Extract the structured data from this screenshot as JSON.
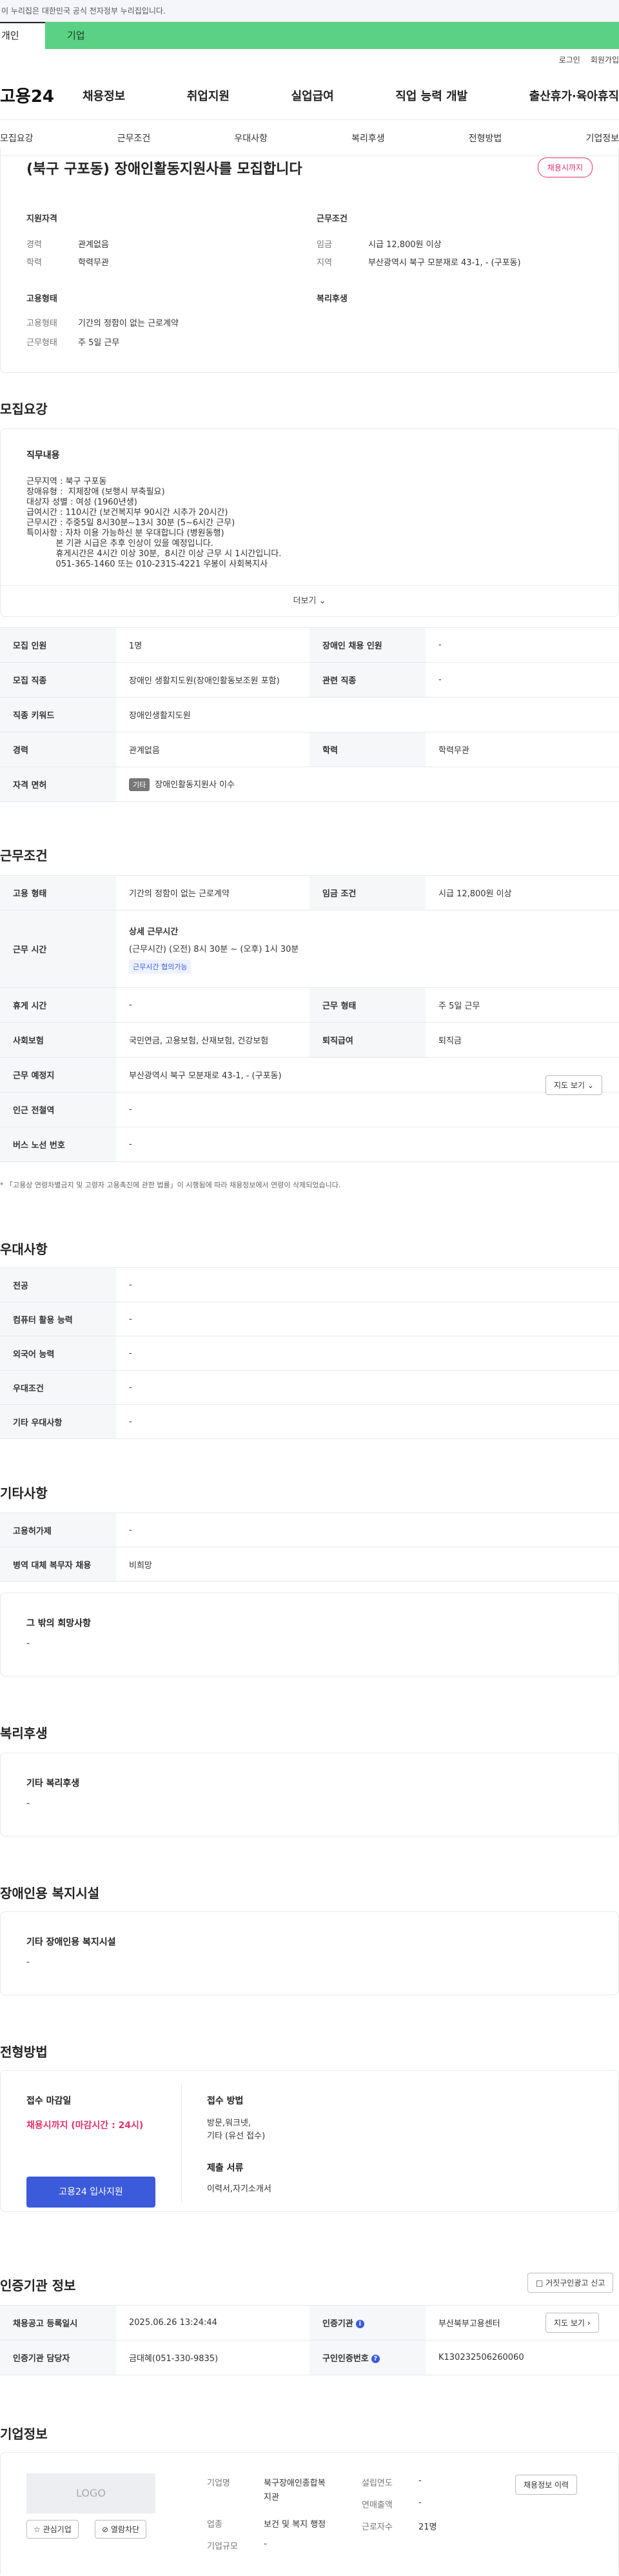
{
  "gov_notice": "이 누리집은 대한민국 공식 전자정부 누리집입니다.",
  "usertype": {
    "personal": "개인",
    "corporate": "기업"
  },
  "util": {
    "login": "로그인",
    "signup": "회원가입"
  },
  "logo": "고용24",
  "gnb": [
    "채용정보",
    "취업지원",
    "실업급여",
    "직업 능력 개발",
    "출산휴가·육아휴직"
  ],
  "tabs": [
    "모집요강",
    "근무조건",
    "우대사항",
    "복리후생",
    "전형방법",
    "기업정보"
  ],
  "job": {
    "title": "(북구 구포동) 장애인활동지원사를 모집합니다",
    "badge": "채용시까지",
    "qual_h": "지원자격",
    "cond_h": "근무조건",
    "career_k": "경력",
    "career_v": "관계없음",
    "edu_k": "학력",
    "edu_v": "학력무관",
    "wage_k": "임금",
    "wage_v": "시급 12,800원 이상",
    "region_k": "지역",
    "region_v": "부산광역시 북구 모분재로 43-1, - (구포동)",
    "emp_h": "고용형태",
    "welfare_h": "복리후생",
    "emptype_k": "고용형태",
    "emptype_v": "기간의 정함이 없는 근로계약",
    "worktype_k": "근무형태",
    "worktype_v": "주 5일 근무"
  },
  "recruit": {
    "title": "모집요강",
    "duty_h": "직무내용",
    "duty_lines": [
      "근무지역 : 북구 구포동",
      "장애유형 :  지체장애 (보행시 부축필요)",
      "대상자 성별 : 여성 (1960년생)",
      "급여시간 : 110시간 (보건복지부 90시간 시추가 20시간)",
      "근무시간 : 주중5일 8시30분~13시 30분 (5~6시간 근무)",
      "특이사항 : 자차 이용 가능하신 분 우대합니다 (병원동행)",
      "           본 기관 시급은 추후 인상이 있을 예정입니다.",
      "           휴게시간은 4시간 이상 30분,  8시간 이상 근무 시 1시간입니다.",
      "           051-365-1460 또는 010-2315-4221 우봉이 사회복지사"
    ],
    "more": "더보기",
    "rows": [
      {
        "k1": "모집 인원",
        "v1": "1명",
        "k2": "장애인 채용 인원",
        "v2": "-"
      },
      {
        "k1": "모집 직종",
        "v1": "장애인 생활지도원(장애인활동보조원 포함)",
        "k2": "관련 직종",
        "v2": "-"
      },
      {
        "k1": "직종 키워드",
        "v1": "장애인생활지도원"
      },
      {
        "k1": "경력",
        "v1": "관계없음",
        "k2": "학력",
        "v2": "학력무관"
      },
      {
        "k1": "자격 면허",
        "chip": "기타",
        "v1": "장애인활동지원사 이수"
      }
    ]
  },
  "conditions": {
    "title": "근무조건",
    "emptype_k": "고용 형태",
    "emptype_v": "기간의 정함이 없는 근로계약",
    "wage_k": "임금 조건",
    "wage_v": "시급 12,800원 이상",
    "time_k": "근무 시간",
    "time_h": "상세 근무시간",
    "time_v": "(근무시간) (오전) 8시 30분 ~ (오후) 1시 30분",
    "time_tag": "근무시간 협의가능",
    "rest_k": "휴게 시간",
    "rest_v": "-",
    "worktype_k": "근무 형태",
    "worktype_v": "주 5일 근무",
    "ins_k": "사회보험",
    "ins_v": "국민연금, 고용보험, 산재보험, 건강보험",
    "sev_k": "퇴직급여",
    "sev_v": "퇴직금",
    "place_k": "근무 예정지",
    "place_v": "부산광역시 북구 모분재로 43-1, - (구포동)",
    "map_btn": "지도 보기",
    "subway_k": "인근 전철역",
    "subway_v": "-",
    "bus_k": "버스 노선 번호",
    "bus_v": "-",
    "note": "* 「고용상 연령차별금지 및 고령자 고용촉진에 관한 법률」이 시행됨에 따라 채용정보에서 연령이 삭제되었습니다."
  },
  "preference": {
    "title": "우대사항",
    "rows": [
      {
        "k": "전공",
        "v": "-"
      },
      {
        "k": "컴퓨터 활용 능력",
        "v": "-"
      },
      {
        "k": "외국어 능력",
        "v": "-"
      },
      {
        "k": "우대조건",
        "v": "-"
      },
      {
        "k": "기타 우대사항",
        "v": "-"
      }
    ]
  },
  "etc": {
    "title": "기타사항",
    "rows": [
      {
        "k": "고용허가제",
        "v": "-"
      },
      {
        "k": "병역 대체 복무자 채용",
        "v": "비희망"
      }
    ],
    "other_h": "그 밖의 희망사항",
    "other_v": "-"
  },
  "welfare": {
    "title": "복리후생",
    "h": "기타 복리후생",
    "v": "-"
  },
  "disabled": {
    "title": "장애인용 복지시설",
    "h": "기타 장애인용 복지시설",
    "v": "-"
  },
  "selection": {
    "title": "전형방법",
    "deadline_h": "접수 마감일",
    "deadline_v": "채용시까지 (마감시간 : 24시)",
    "apply_btn": "고용24 입사지원",
    "method_h": "접수 방법",
    "method_v1": "방문,워크넷,",
    "method_v2": "기타 (유선 접수)",
    "docs_h": "제출 서류",
    "docs_v": "이력서,자기소개서"
  },
  "agency": {
    "title": "인증기관 정보",
    "report_btn": "거짓구인광고 신고",
    "reg_k": "채용공고 등록일시",
    "reg_v": "2025.06.26 13:24:44",
    "cert_k": "인증기관",
    "cert_v": "부산북부고용센터",
    "map_btn": "지도 보기",
    "staff_k": "인증기관 담당자",
    "staff_v": "금대혜(051-330-9835)",
    "num_k": "구인인증번호",
    "num_v": "K130232506260060"
  },
  "company": {
    "title": "기업정보",
    "logo": "LOGO",
    "fav_btn": "관심기업",
    "block_btn": "열람차단",
    "name_k": "기업명",
    "name_v1": "북구장애인종합복",
    "name_v2": "지관",
    "ind_k": "업종",
    "ind_v": "보건 및 복지 행정",
    "size_k": "기업규모",
    "size_v": "-",
    "year_k": "설립연도",
    "year_v": "-",
    "sales_k": "연매출액",
    "sales_v": "-",
    "emp_k": "근로자수",
    "emp_v": "21명",
    "more_btn": "채용정보 이력"
  }
}
